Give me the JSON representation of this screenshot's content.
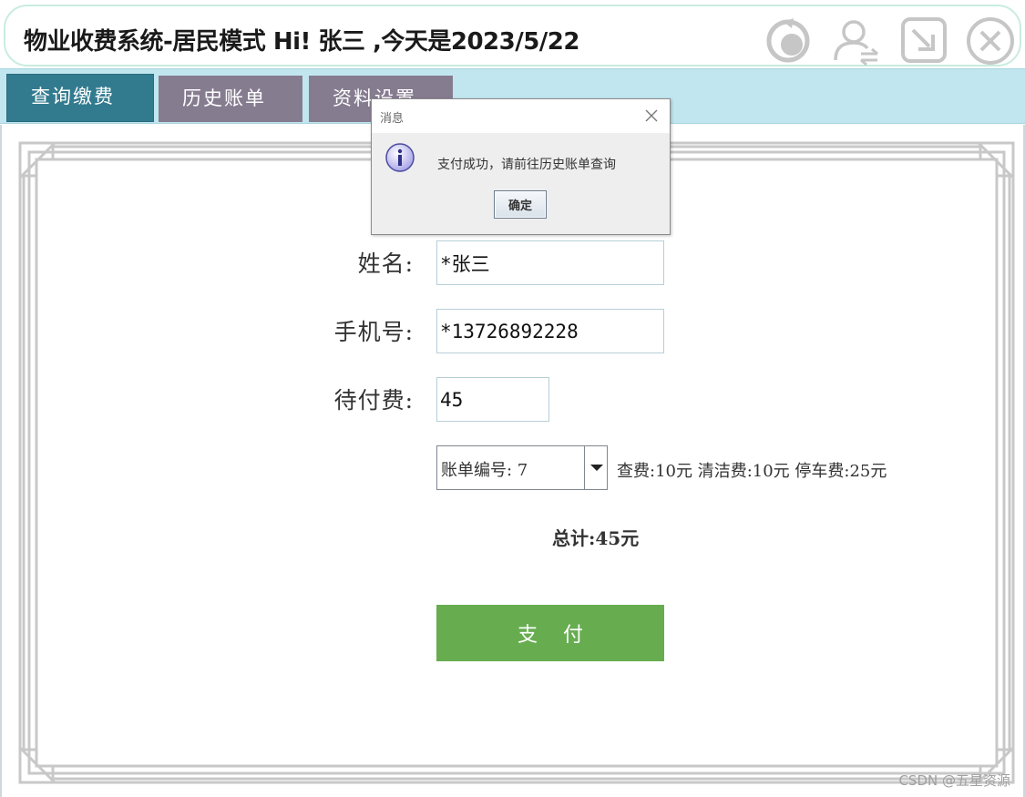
{
  "window": {
    "title": "物业收费系统-居民模式    Hi! 张三 ,今天是2023/5/22",
    "controls": [
      "refresh-icon",
      "switch-user-icon",
      "minimize-icon",
      "close-icon"
    ]
  },
  "tabs": [
    {
      "label": "查询缴费",
      "active": true
    },
    {
      "label": "历史账单",
      "active": false
    },
    {
      "label": "资料设置",
      "active": false
    }
  ],
  "form": {
    "name_label": "姓名:",
    "name_value": "*张三",
    "phone_label": "手机号:",
    "phone_value": "*13726892228",
    "due_label": "待付费:",
    "due_value": "45",
    "bill_select": "账单编号: 7",
    "fee_detail": "查费:10元 清洁费:10元 停车费:25元",
    "total": "总计:45元",
    "pay_button": "支    付"
  },
  "dialog": {
    "title": "消息",
    "message": "支付成功，请前往历史账单查询",
    "ok_button": "确定",
    "icon": "info-icon"
  },
  "watermark": "CSDN @五星资源",
  "colors": {
    "tab_bar": "#c1e6ef",
    "tab_active": "#327b8f",
    "tab_inactive": "#867c90",
    "pay_button": "#67ad50",
    "title_border": "#c9ecdf"
  }
}
